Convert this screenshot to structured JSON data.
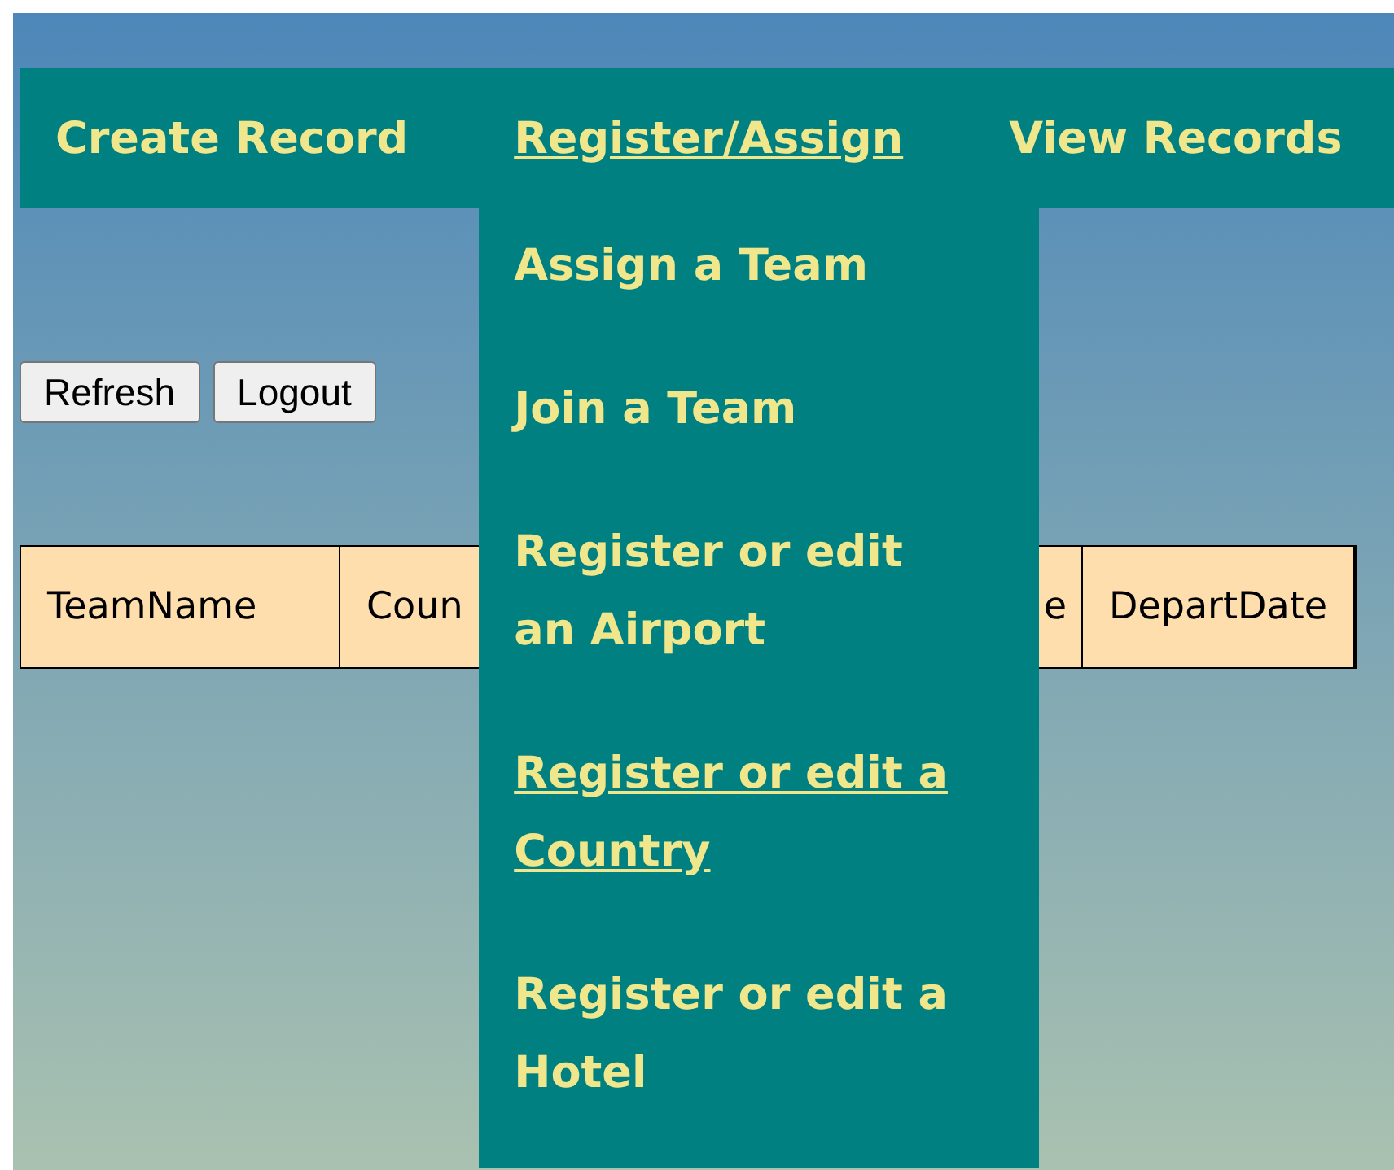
{
  "nav": {
    "items": [
      {
        "label": "Create Record",
        "selected": false
      },
      {
        "label": "Register/Assign",
        "selected": true
      },
      {
        "label": "View Records",
        "selected": false
      }
    ]
  },
  "dropdown": {
    "items": [
      {
        "label": "Assign a Team",
        "selected": false
      },
      {
        "label": "Join a Team",
        "selected": false
      },
      {
        "label": "Register or edit an Airport",
        "selected": false
      },
      {
        "label": "Register or edit a Country",
        "selected": true
      },
      {
        "label": "Register or edit a Hotel",
        "selected": false
      }
    ]
  },
  "buttons": [
    "Refresh",
    "Logout"
  ],
  "table": {
    "columns": [
      "TeamName",
      "Coun",
      "e",
      "DepartDate"
    ]
  }
}
